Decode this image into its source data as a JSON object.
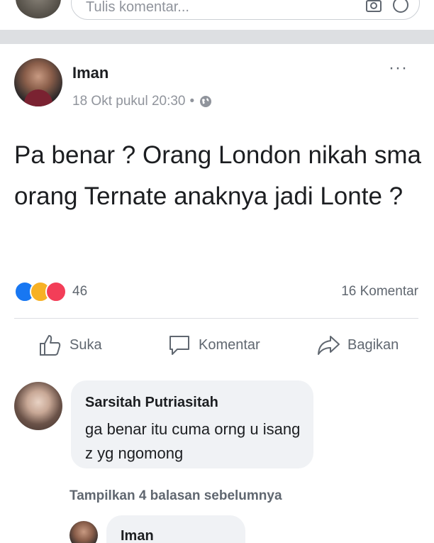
{
  "composer": {
    "placeholder": "Tulis komentar..."
  },
  "post": {
    "author": "Iman",
    "date": "18 Okt pukul 20:30",
    "separator": "•",
    "more_label": "···",
    "text": "Pa benar ? Orang London nikah sma orang Ternate anaknya jadi Lonte ?",
    "reaction_count": "46",
    "comment_count": "16 Komentar"
  },
  "actions": {
    "like": "Suka",
    "comment": "Komentar",
    "share": "Bagikan"
  },
  "comment": {
    "author": "Sarsitah Putriasitah",
    "text": "ga benar itu cuma orng u isang z yg ngomong"
  },
  "view_replies": "Tampilkan 4 balasan sebelumnya",
  "reply": {
    "author": "Iman"
  },
  "colors": {
    "accent": "#1877f2",
    "muted_text": "#90949c",
    "secondary_text": "#606770",
    "bubble_bg": "#f0f2f5",
    "divider": "#dddfe2"
  },
  "icons": [
    "camera-icon",
    "emoji-icon",
    "globe-icon",
    "like-icon",
    "comment-icon",
    "share-icon"
  ]
}
